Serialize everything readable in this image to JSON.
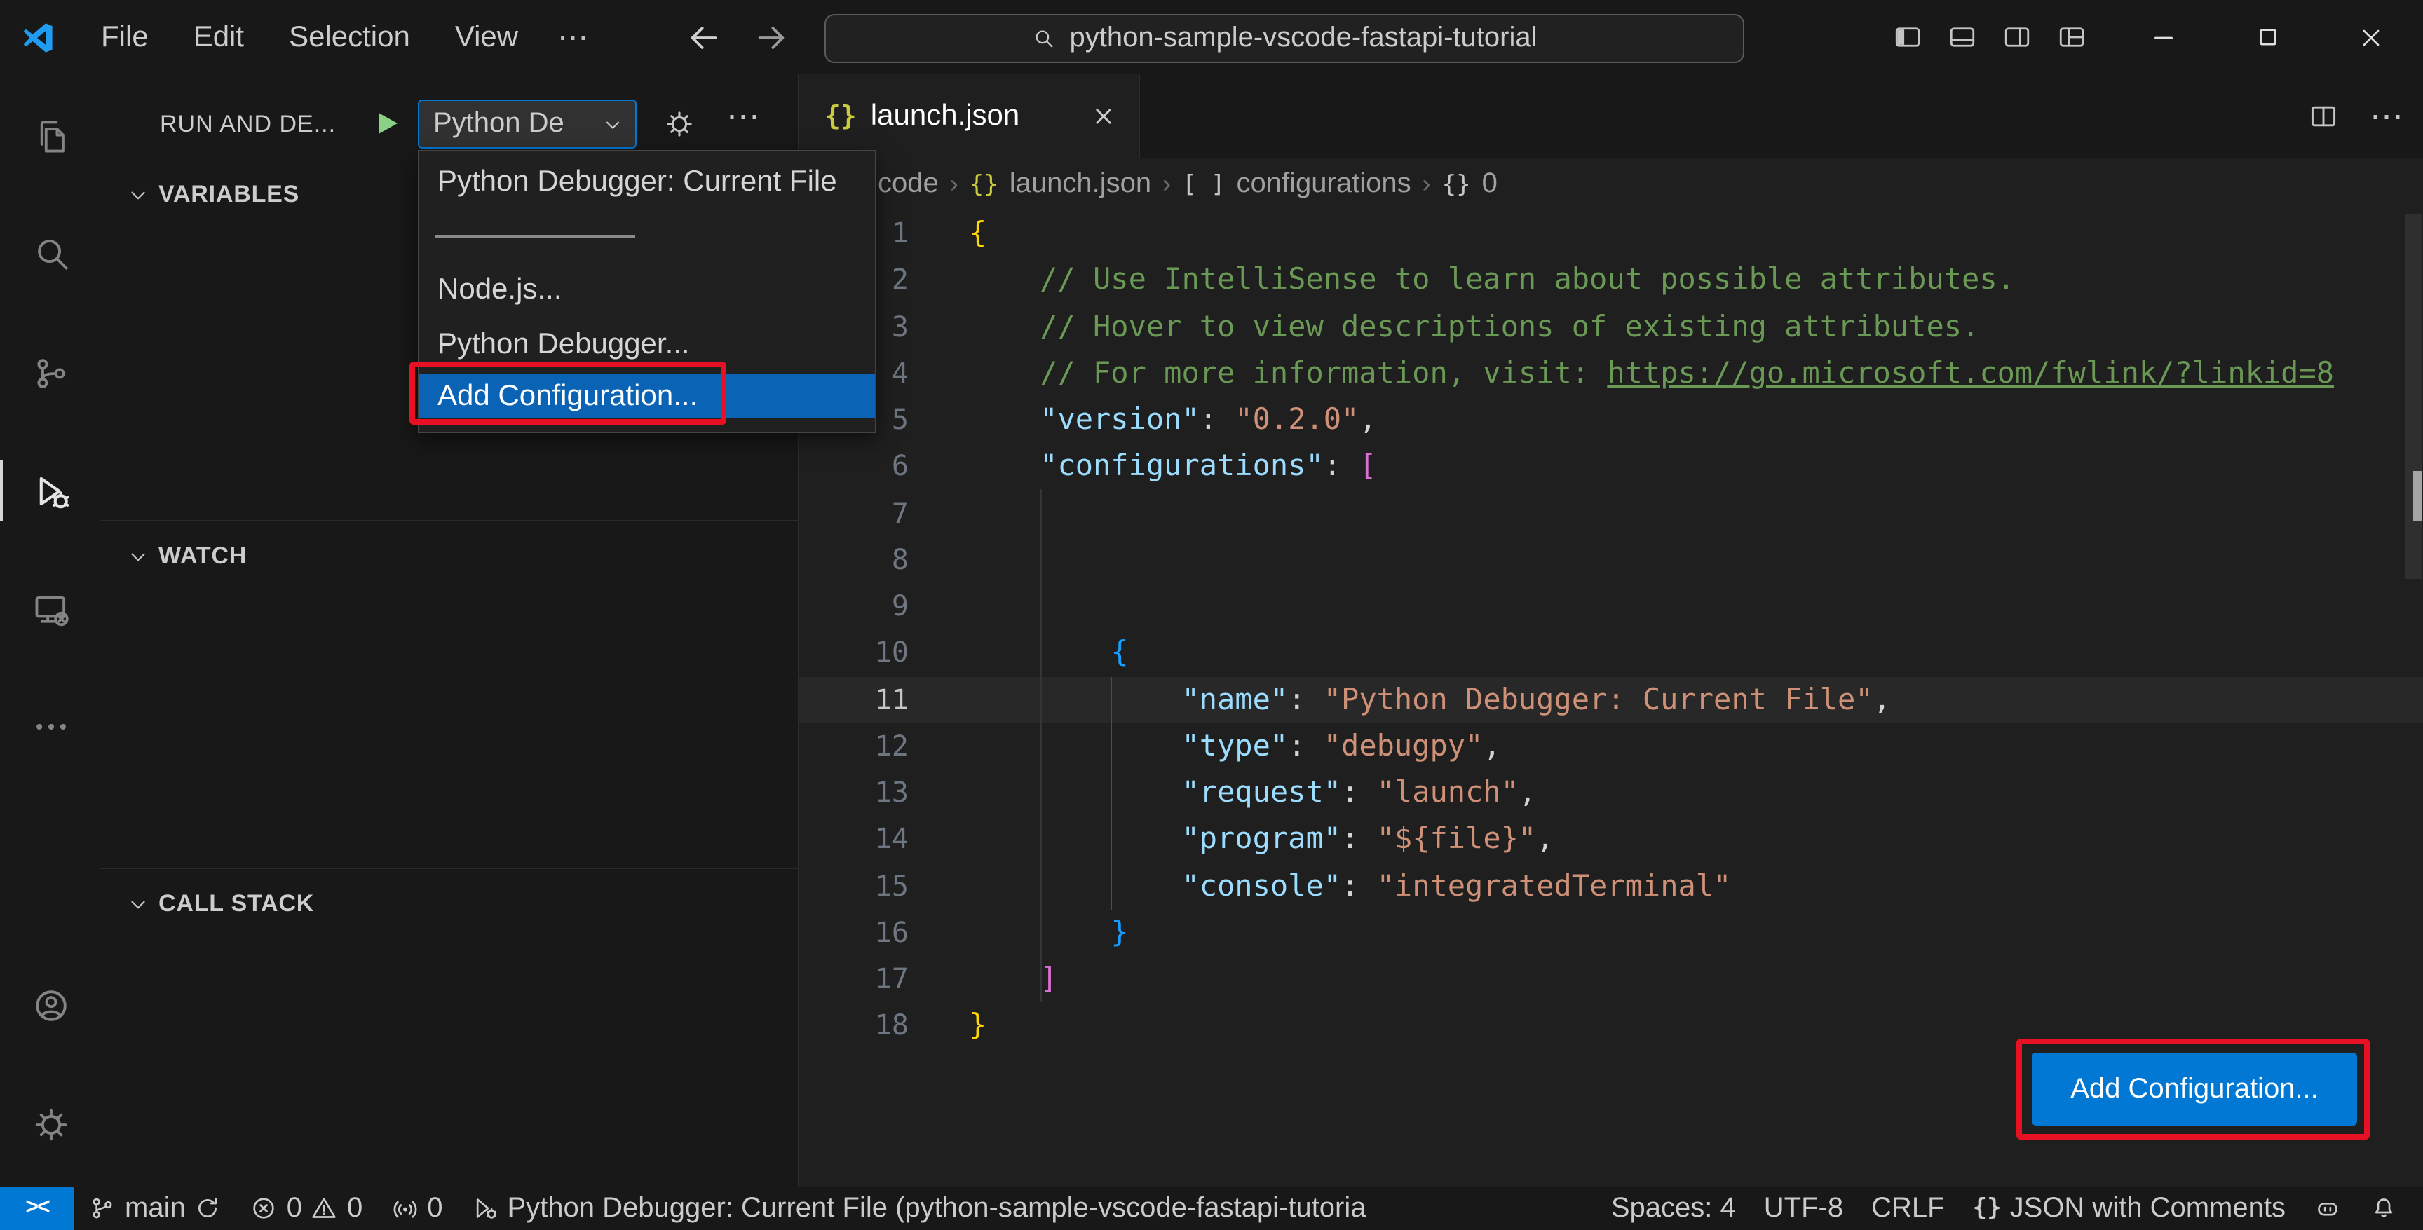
{
  "colors": {
    "accent_blue": "#0078d4",
    "annotation_red": "#e81123",
    "dropdown_highlight": "#0a63b4",
    "comment_green": "#6a9955",
    "string_orange": "#ce9178",
    "key_blue": "#9cdcfe"
  },
  "glyphs": {
    "more": "⋯",
    "object": "{}",
    "array": "[ ]",
    "crumb_sep": "›",
    "remote": "><"
  },
  "title_bar": {
    "menus": [
      "File",
      "Edit",
      "Selection",
      "View"
    ],
    "search_value": "python-sample-vscode-fastapi-tutorial"
  },
  "activity_bar": {
    "items": [
      "explorer",
      "search",
      "source-control",
      "run-and-debug",
      "remote-explorer",
      "more-views",
      "accounts",
      "settings"
    ],
    "active": "run-and-debug"
  },
  "sidebar": {
    "title": "RUN AND DE...",
    "config_picker": {
      "value": "Python De"
    },
    "sections": [
      "VARIABLES",
      "WATCH",
      "CALL STACK"
    ]
  },
  "debug_dropdown": {
    "items": [
      "Python Debugger: Current File",
      "Node.js...",
      "Python Debugger...",
      "Add Configuration..."
    ],
    "highlighted_item": "Add Configuration..."
  },
  "editor": {
    "tab": {
      "label": "launch.json"
    },
    "breadcrumbs": [
      "code",
      "launch.json",
      "configurations",
      "0"
    ],
    "add_configuration_button": "Add Configuration...",
    "active_line": 11,
    "lines": [
      {
        "n": 1,
        "tokens": [
          {
            "t": "{",
            "c": "b1"
          }
        ]
      },
      {
        "n": 2,
        "tokens": [
          {
            "t": "    ",
            "c": "pn"
          },
          {
            "t": "// Use IntelliSense to learn about possible attributes.",
            "c": "cm"
          }
        ]
      },
      {
        "n": 3,
        "tokens": [
          {
            "t": "    ",
            "c": "pn"
          },
          {
            "t": "// Hover to view descriptions of existing attributes.",
            "c": "cm"
          }
        ]
      },
      {
        "n": 4,
        "tokens": [
          {
            "t": "    ",
            "c": "pn"
          },
          {
            "t": "// For more information, visit: ",
            "c": "cm"
          },
          {
            "t": "https://go.microsoft.com/fwlink/?linkid=8",
            "c": "lk"
          }
        ]
      },
      {
        "n": 5,
        "tokens": [
          {
            "t": "    ",
            "c": "pn"
          },
          {
            "t": "\"version\"",
            "c": "key"
          },
          {
            "t": ": ",
            "c": "pn"
          },
          {
            "t": "\"0.2.0\"",
            "c": "str"
          },
          {
            "t": ",",
            "c": "pn"
          }
        ]
      },
      {
        "n": 6,
        "tokens": [
          {
            "t": "    ",
            "c": "pn"
          },
          {
            "t": "\"configurations\"",
            "c": "key"
          },
          {
            "t": ": ",
            "c": "pn"
          },
          {
            "t": "[",
            "c": "b2"
          }
        ]
      },
      {
        "n": 7,
        "tokens": []
      },
      {
        "n": 8,
        "tokens": []
      },
      {
        "n": 9,
        "tokens": []
      },
      {
        "n": 10,
        "tokens": [
          {
            "t": "        ",
            "c": "pn"
          },
          {
            "t": "{",
            "c": "b3"
          }
        ]
      },
      {
        "n": 11,
        "tokens": [
          {
            "t": "            ",
            "c": "pn"
          },
          {
            "t": "\"name\"",
            "c": "key"
          },
          {
            "t": ": ",
            "c": "pn"
          },
          {
            "t": "\"Python Debugger: Current File\"",
            "c": "str"
          },
          {
            "t": ",",
            "c": "pn"
          }
        ]
      },
      {
        "n": 12,
        "tokens": [
          {
            "t": "            ",
            "c": "pn"
          },
          {
            "t": "\"type\"",
            "c": "key"
          },
          {
            "t": ": ",
            "c": "pn"
          },
          {
            "t": "\"debugpy\"",
            "c": "str"
          },
          {
            "t": ",",
            "c": "pn"
          }
        ]
      },
      {
        "n": 13,
        "tokens": [
          {
            "t": "            ",
            "c": "pn"
          },
          {
            "t": "\"request\"",
            "c": "key"
          },
          {
            "t": ": ",
            "c": "pn"
          },
          {
            "t": "\"launch\"",
            "c": "str"
          },
          {
            "t": ",",
            "c": "pn"
          }
        ]
      },
      {
        "n": 14,
        "tokens": [
          {
            "t": "            ",
            "c": "pn"
          },
          {
            "t": "\"program\"",
            "c": "key"
          },
          {
            "t": ": ",
            "c": "pn"
          },
          {
            "t": "\"${file}\"",
            "c": "str"
          },
          {
            "t": ",",
            "c": "pn"
          }
        ]
      },
      {
        "n": 15,
        "tokens": [
          {
            "t": "            ",
            "c": "pn"
          },
          {
            "t": "\"console\"",
            "c": "key"
          },
          {
            "t": ": ",
            "c": "pn"
          },
          {
            "t": "\"integratedTerminal\"",
            "c": "str"
          }
        ]
      },
      {
        "n": 16,
        "tokens": [
          {
            "t": "        ",
            "c": "pn"
          },
          {
            "t": "}",
            "c": "b3"
          }
        ]
      },
      {
        "n": 17,
        "tokens": [
          {
            "t": "    ",
            "c": "pn"
          },
          {
            "t": "]",
            "c": "b2"
          }
        ]
      },
      {
        "n": 18,
        "tokens": [
          {
            "t": "}",
            "c": "b1"
          }
        ]
      }
    ]
  },
  "status_bar": {
    "branch": "main",
    "errors": "0",
    "warnings": "0",
    "ports": "0",
    "debug_status": "Python Debugger: Current File (python-sample-vscode-fastapi-tutoria",
    "spaces": "Spaces: 4",
    "encoding": "UTF-8",
    "eol": "CRLF",
    "language": "JSON with Comments"
  }
}
